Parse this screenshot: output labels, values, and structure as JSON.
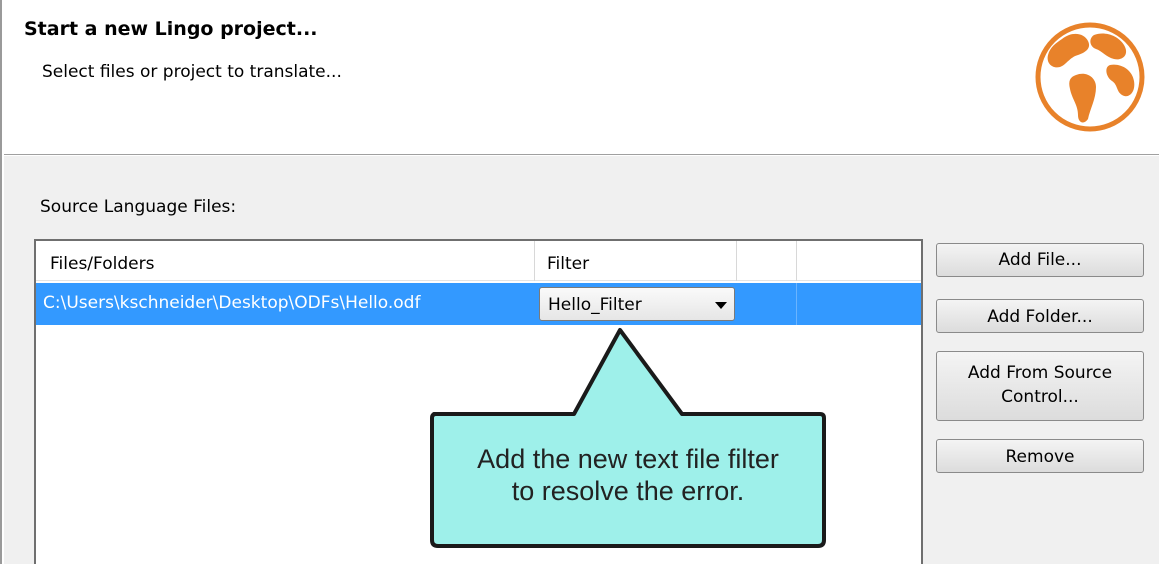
{
  "header": {
    "title": "Start a new Lingo project...",
    "subtitle": "Select files or project to translate..."
  },
  "source_files": {
    "label": "Source Language Files:",
    "columns": [
      "Files/Folders",
      "Filter"
    ],
    "rows": [
      {
        "path": "C:\\Users\\kschneider\\Desktop\\ODFs\\Hello.odf",
        "filter": "Hello_Filter",
        "selected": true
      }
    ]
  },
  "buttons": {
    "add_file": "Add File...",
    "add_folder": "Add Folder...",
    "add_from_source_line1": "Add From Source",
    "add_from_source_line2": "Control...",
    "remove": "Remove"
  },
  "callout": {
    "line1": "Add the new text file filter",
    "line2": "to resolve the error."
  },
  "colors": {
    "selection": "#3399ff",
    "callout_fill": "#9ef0ea",
    "globe": "#e8822a"
  },
  "icons": {
    "globe": "globe-icon",
    "dropdown": "chevron-down-icon"
  }
}
